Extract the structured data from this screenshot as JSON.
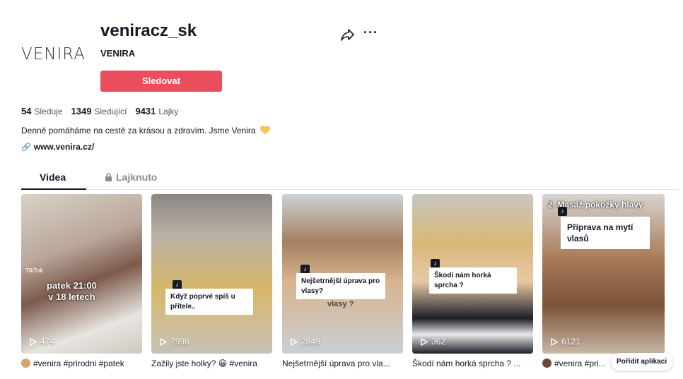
{
  "profile": {
    "logo_text": "VENIRA",
    "username": "veniracz_sk",
    "nickname": "VENIRA",
    "follow_label": "Sledovat",
    "stats": [
      {
        "num": "54",
        "label": "Sleduje"
      },
      {
        "num": "1349",
        "label": "Sledující"
      },
      {
        "num": "9431",
        "label": "Lajky"
      }
    ],
    "bio": "Denně pomáháme na cestě za krásou a zdravím. Jsme Venira",
    "website": "www.venira.cz/"
  },
  "tabs": {
    "videos": "Videa",
    "liked": "Lajknuto"
  },
  "videos": [
    {
      "views": "474",
      "caption": "#venira #prirodni #patek",
      "overlay": "patek 21:00\nv 18 letech",
      "watermark": "TikTok"
    },
    {
      "views": "7998",
      "caption": "Zažily jste holky? 😀 #venira",
      "overlay": "Když poprvé spíš u přítele.."
    },
    {
      "views": "2849",
      "caption": "Nejšetrnější úprava pro vla...",
      "overlay": "Nejšetrnější úprava pro vlasy?",
      "overlay_back": "vlasy ?"
    },
    {
      "views": "362",
      "caption": "Škodí nám horká sprcha ? ...",
      "overlay": "Škodí nám horká sprcha ?"
    },
    {
      "views": "6121",
      "caption": "#venira #pri...",
      "overlay_top": "2. Masáž pokožky hlavy",
      "overlay": "Příprava na mytí vlasů"
    }
  ],
  "get_app_label": "Pořídit aplikaci",
  "colors": {
    "accent": "#ea4d5b",
    "text": "#161823",
    "muted": "#8a8b91"
  }
}
